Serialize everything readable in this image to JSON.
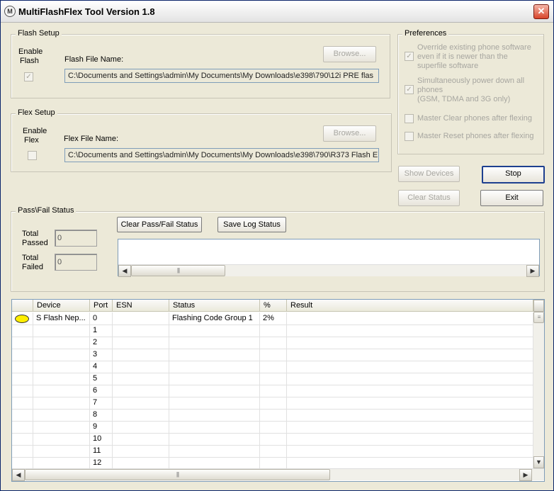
{
  "window": {
    "title": "MultiFlashFlex Tool Version 1.8",
    "icon": "motorola-logo-icon",
    "close_label": "✕"
  },
  "flash_setup": {
    "legend": "Flash Setup",
    "enable_label_1": "Enable",
    "enable_label_2": "Flash",
    "file_label": "Flash File Name:",
    "browse_label": "Browse...",
    "file_value": "C:\\Documents and Settings\\admin\\My Documents\\My Downloads\\e398\\790\\12i PRE flas",
    "checked": true
  },
  "flex_setup": {
    "legend": "Flex Setup",
    "enable_label_1": "Enable",
    "enable_label_2": "Flex",
    "file_label": "Flex File Name:",
    "browse_label": "Browse...",
    "file_value": "C:\\Documents and Settings\\admin\\My Documents\\My Downloads\\e398\\790\\R373 Flash E",
    "checked": false
  },
  "preferences": {
    "legend": "Preferences",
    "items": [
      {
        "lines": [
          "Override existing phone software",
          "even if it is newer than the",
          "superfile software"
        ],
        "checked": true
      },
      {
        "lines": [
          "Simultaneously power down all",
          "phones",
          "(GSM, TDMA and 3G only)"
        ],
        "checked": true
      },
      {
        "lines": [
          "Master Clear phones after flexing"
        ],
        "checked": false
      },
      {
        "lines": [
          "Master Reset phones after flexing"
        ],
        "checked": false
      }
    ]
  },
  "actions": {
    "show_devices": "Show Devices",
    "stop": "Stop",
    "clear_status": "Clear Status",
    "exit": "Exit"
  },
  "pass_fail": {
    "legend": "Pass\\Fail Status",
    "total_passed_1": "Total",
    "total_passed_2": "Passed",
    "total_passed_value": "0",
    "total_failed_1": "Total",
    "total_failed_2": "Failed",
    "total_failed_value": "0",
    "clear_btn": "Clear Pass/Fail Status",
    "save_btn": "Save Log Status"
  },
  "table": {
    "columns": [
      "",
      "Device",
      "Port",
      "ESN",
      "Status",
      "%",
      "Result"
    ],
    "rows": [
      {
        "device": "S Flash Nep...",
        "port": "0",
        "esn": "",
        "status": "Flashing Code Group 1",
        "percent": "2%",
        "result": "",
        "led": true
      },
      {
        "device": "",
        "port": "1",
        "esn": "",
        "status": "",
        "percent": "",
        "result": "",
        "led": false
      },
      {
        "device": "",
        "port": "2",
        "esn": "",
        "status": "",
        "percent": "",
        "result": "",
        "led": false
      },
      {
        "device": "",
        "port": "3",
        "esn": "",
        "status": "",
        "percent": "",
        "result": "",
        "led": false
      },
      {
        "device": "",
        "port": "4",
        "esn": "",
        "status": "",
        "percent": "",
        "result": "",
        "led": false
      },
      {
        "device": "",
        "port": "5",
        "esn": "",
        "status": "",
        "percent": "",
        "result": "",
        "led": false
      },
      {
        "device": "",
        "port": "6",
        "esn": "",
        "status": "",
        "percent": "",
        "result": "",
        "led": false
      },
      {
        "device": "",
        "port": "7",
        "esn": "",
        "status": "",
        "percent": "",
        "result": "",
        "led": false
      },
      {
        "device": "",
        "port": "8",
        "esn": "",
        "status": "",
        "percent": "",
        "result": "",
        "led": false
      },
      {
        "device": "",
        "port": "9",
        "esn": "",
        "status": "",
        "percent": "",
        "result": "",
        "led": false
      },
      {
        "device": "",
        "port": "10",
        "esn": "",
        "status": "",
        "percent": "",
        "result": "",
        "led": false
      },
      {
        "device": "",
        "port": "11",
        "esn": "",
        "status": "",
        "percent": "",
        "result": "",
        "led": false
      },
      {
        "device": "",
        "port": "12",
        "esn": "",
        "status": "",
        "percent": "",
        "result": "",
        "led": false
      }
    ]
  },
  "colors": {
    "led": "#ffee00",
    "window_bg": "#ece9d8",
    "accent": "#1d3f8f"
  }
}
